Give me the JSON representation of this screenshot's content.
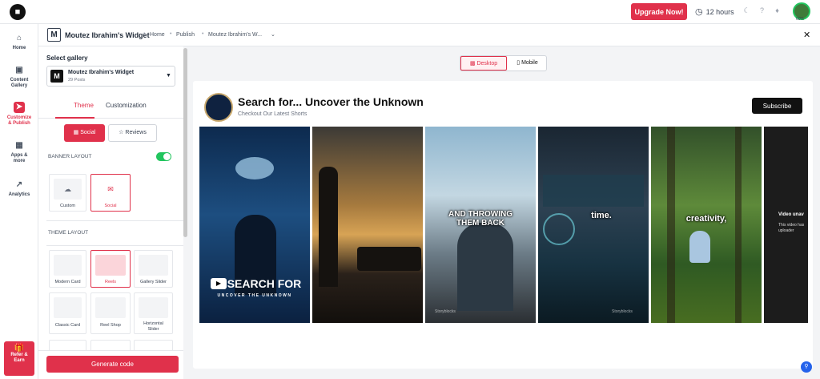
{
  "topbar": {
    "upgrade_label": "Upgrade Now!",
    "hours_label": "12 hours",
    "avatar_pct": "60%"
  },
  "nav": {
    "items": [
      {
        "label": "Home",
        "icon": "home-icon"
      },
      {
        "label": "Content Gallery",
        "icon": "image-icon"
      },
      {
        "label": "Customize & Publish",
        "icon": "send-icon"
      },
      {
        "label": "Apps & more",
        "icon": "grid-icon"
      },
      {
        "label": "Analytics",
        "icon": "chart-icon"
      }
    ],
    "refer_label": "Refer & Earn"
  },
  "subbar": {
    "widget_initial": "M",
    "widget_name": "Moutez Ibrahim's Widget",
    "crumbs": [
      "Home",
      "Publish",
      "Moutez Ibrahim's W..."
    ]
  },
  "panel": {
    "select_gallery_label": "Select gallery",
    "gallery": {
      "initial": "M",
      "name": "Moutez Ibrahim's Widget",
      "posts": "29 Posts"
    },
    "tabs": [
      "Theme",
      "Customization"
    ],
    "segments": [
      "Social",
      "Reviews"
    ],
    "banner_layout_label": "BANNER LAYOUT",
    "banner_toggle": true,
    "banner_options": [
      "Custom",
      "Social"
    ],
    "theme_layout_label": "THEME LAYOUT",
    "theme_options": [
      "Modern Card",
      "Reels",
      "Gallery Slider",
      "Classic Card",
      "Reel Shop",
      "Horizontal Slider"
    ],
    "generate_label": "Generate code"
  },
  "preview": {
    "device_options": [
      "Desktop",
      "Mobile"
    ],
    "channel_title": "Search for... Uncover the Unknown",
    "channel_sub": "Checkout Our Latest Shorts",
    "subscribe_label": "Subscribe",
    "shorts": [
      {
        "caption": "SEARCH FOR",
        "subcaption": "UNCOVER THE UNKNOWN"
      },
      {
        "caption": ""
      },
      {
        "caption": "AND THROWING THEM BACK"
      },
      {
        "caption": "time."
      },
      {
        "caption": "creativity,"
      },
      {
        "caption": "Video unav",
        "note": "This video has uploader"
      }
    ],
    "watermark": "Storyblocks"
  },
  "colors": {
    "accent": "#e0314b",
    "toggle_on": "#22c55e"
  }
}
